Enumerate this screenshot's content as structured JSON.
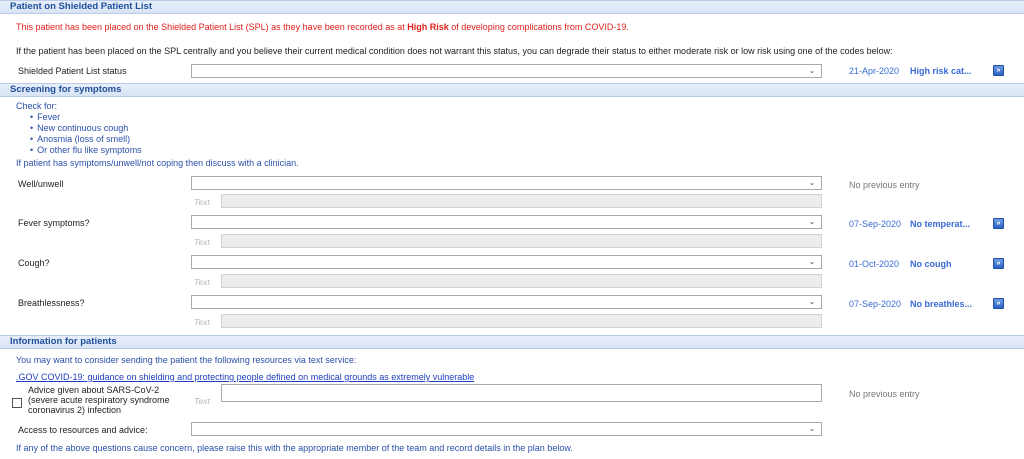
{
  "sections": {
    "spl": {
      "title": "Patient on Shielded Patient List"
    },
    "screening": {
      "title": "Screening for symptoms"
    },
    "info": {
      "title": "Information for patients"
    }
  },
  "spl": {
    "warning_prefix": "This patient has been placed on the Shielded Patient List (SPL) as they have been recorded as at ",
    "warning_bold": "High Risk",
    "warning_suffix": " of developing complications from COVID-19.",
    "instruction": "If the patient has been placed on the SPL centrally and you believe their current medical condition does not warrant this status, you can degrade their status to either moderate risk or low risk using one of the codes below:",
    "status_label": "Shielded Patient List status",
    "status_value": "",
    "prev_date": "21-Apr-2020",
    "prev_value": "High risk cat..."
  },
  "screening": {
    "check_for": "Check for:",
    "bullets": [
      "Fever",
      "New continuous cough",
      "Anosmia (loss of smell)",
      "Or other flu like symptoms"
    ],
    "advice": "If patient has symptoms/unwell/not coping then discuss with a clinician.",
    "text_placeholder": "Text",
    "rows": [
      {
        "label": "Well/unwell",
        "prev_date": "",
        "prev_value": "No previous entry"
      },
      {
        "label": "Fever symptoms?",
        "prev_date": "07-Sep-2020",
        "prev_value": "No temperat..."
      },
      {
        "label": "Cough?",
        "prev_date": "01-Oct-2020",
        "prev_value": "No cough"
      },
      {
        "label": "Breathlessness?",
        "prev_date": "07-Sep-2020",
        "prev_value": "No breathles..."
      }
    ]
  },
  "info": {
    "intro": "You may want to consider sending the patient the following resources via text service:",
    "link": ".GOV COVID-19: guidance on shielding and protecting people defined on medical grounds as extremely vulnerable",
    "advice_label_1": "Advice given about SARS-CoV-2",
    "advice_label_2": "(severe acute respiratory syndrome",
    "advice_label_3": "coronavirus 2) infection",
    "advice_text_placeholder": "Text",
    "advice_prev": "No previous entry",
    "access_label": "Access to resources and advice:",
    "footer": "If any of the above questions cause concern, please raise this with the appropriate member of the team and record details in the plan below."
  },
  "icons": {
    "dropdown": "chevron-down-icon",
    "go": "double-chevron-right-icon"
  },
  "colors": {
    "header_text": "#1f4f9a",
    "warning": "#e0201c",
    "accent": "#3a6ad4"
  }
}
